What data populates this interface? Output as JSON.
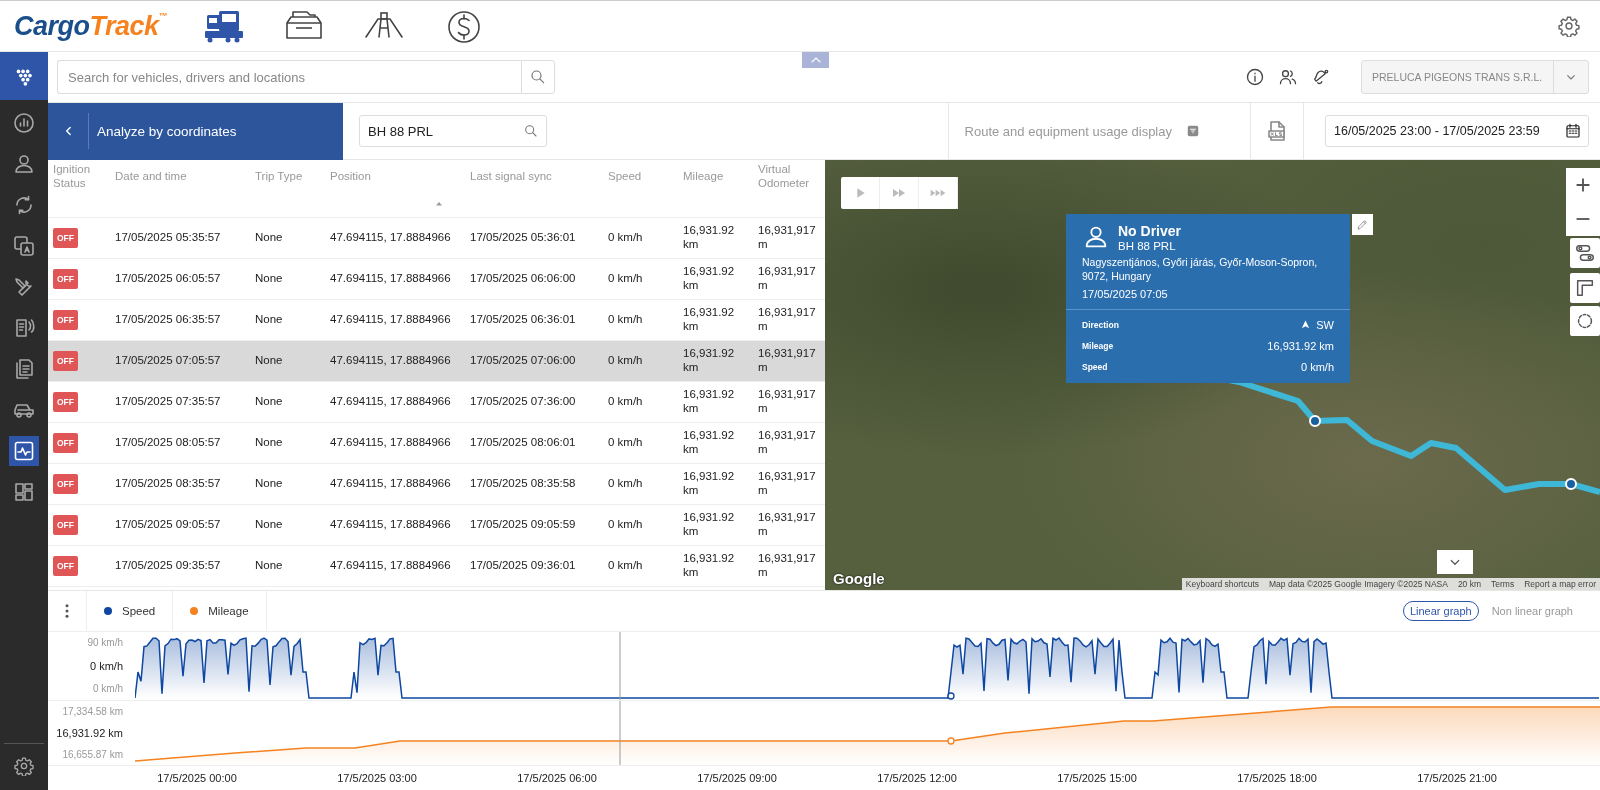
{
  "header": {
    "logo": {
      "primary": "Cargo",
      "accent": "Track",
      "mark": "™"
    },
    "modules": [
      {
        "kind": "fleet",
        "selected": true
      },
      {
        "kind": "archive",
        "selected": false
      },
      {
        "kind": "road",
        "selected": false
      },
      {
        "kind": "finance",
        "selected": false
      }
    ]
  },
  "sidebar": {
    "items": [
      {
        "kind": "stats",
        "selected": false
      },
      {
        "kind": "person",
        "selected": false
      },
      {
        "kind": "sync",
        "selected": false
      },
      {
        "kind": "translate",
        "selected": false
      },
      {
        "kind": "tools",
        "selected": false
      },
      {
        "kind": "notes",
        "selected": false
      },
      {
        "kind": "documents",
        "selected": false
      },
      {
        "kind": "vehicle",
        "selected": false
      },
      {
        "kind": "activity",
        "selected": true
      },
      {
        "kind": "dashboard",
        "selected": false
      }
    ]
  },
  "search": {
    "placeholder": "Search for vehicles, drivers and locations"
  },
  "account": {
    "company": "PRELUCA PIGEONS TRANS S.R.L."
  },
  "toolbar": {
    "title": "Analyze by coordinates",
    "vehicle_field": {
      "value": "BH 88 PRL"
    },
    "display_mode": "Route and equipment usage display",
    "date_range": "16/05/2025 23:00 - 17/05/2025 23:59"
  },
  "table": {
    "columns": [
      "Ignition Status",
      "Date and time",
      "Trip Type",
      "Position",
      "Last signal sync",
      "Speed",
      "Mileage",
      "Virtual Odometer"
    ],
    "rows": [
      {
        "ignition": "OFF",
        "date_time": "17/05/2025 05:35:57",
        "trip_type": "None",
        "position": "47.694115, 17.8884966",
        "last_sync": "17/05/2025 05:36:01",
        "speed": "0 km/h",
        "mileage": "16,931.92 km",
        "odometer": "16,931,917 m",
        "selected": false
      },
      {
        "ignition": "OFF",
        "date_time": "17/05/2025 06:05:57",
        "trip_type": "None",
        "position": "47.694115, 17.8884966",
        "last_sync": "17/05/2025 06:06:00",
        "speed": "0 km/h",
        "mileage": "16,931.92 km",
        "odometer": "16,931,917 m",
        "selected": false
      },
      {
        "ignition": "OFF",
        "date_time": "17/05/2025 06:35:57",
        "trip_type": "None",
        "position": "47.694115, 17.8884966",
        "last_sync": "17/05/2025 06:36:01",
        "speed": "0 km/h",
        "mileage": "16,931.92 km",
        "odometer": "16,931,917 m",
        "selected": false
      },
      {
        "ignition": "OFF",
        "date_time": "17/05/2025 07:05:57",
        "trip_type": "None",
        "position": "47.694115, 17.8884966",
        "last_sync": "17/05/2025 07:06:00",
        "speed": "0 km/h",
        "mileage": "16,931.92 km",
        "odometer": "16,931,917 m",
        "selected": true
      },
      {
        "ignition": "OFF",
        "date_time": "17/05/2025 07:35:57",
        "trip_type": "None",
        "position": "47.694115, 17.8884966",
        "last_sync": "17/05/2025 07:36:00",
        "speed": "0 km/h",
        "mileage": "16,931.92 km",
        "odometer": "16,931,917 m",
        "selected": false
      },
      {
        "ignition": "OFF",
        "date_time": "17/05/2025 08:05:57",
        "trip_type": "None",
        "position": "47.694115, 17.8884966",
        "last_sync": "17/05/2025 08:06:01",
        "speed": "0 km/h",
        "mileage": "16,931.92 km",
        "odometer": "16,931,917 m",
        "selected": false
      },
      {
        "ignition": "OFF",
        "date_time": "17/05/2025 08:35:57",
        "trip_type": "None",
        "position": "47.694115, 17.8884966",
        "last_sync": "17/05/2025 08:35:58",
        "speed": "0 km/h",
        "mileage": "16,931.92 km",
        "odometer": "16,931,917 m",
        "selected": false
      },
      {
        "ignition": "OFF",
        "date_time": "17/05/2025 09:05:57",
        "trip_type": "None",
        "position": "47.694115, 17.8884966",
        "last_sync": "17/05/2025 09:05:59",
        "speed": "0 km/h",
        "mileage": "16,931.92 km",
        "odometer": "16,931,917 m",
        "selected": false
      },
      {
        "ignition": "OFF",
        "date_time": "17/05/2025 09:35:57",
        "trip_type": "None",
        "position": "47.694115, 17.8884966",
        "last_sync": "17/05/2025 09:36:01",
        "speed": "0 km/h",
        "mileage": "16,931.92 km",
        "odometer": "16,931,917 m",
        "selected": false
      }
    ]
  },
  "map": {
    "popup": {
      "driver": "No Driver",
      "plate": "BH 88 PRL",
      "address": "Nagyszentjános, Győri járás, Győr-Moson-Sopron, 9072, Hungary",
      "time": "17/05/2025 07:05",
      "details": [
        {
          "kind": "direction",
          "label": "Direction",
          "value": "SW"
        },
        {
          "kind": "plain",
          "label": "Mileage",
          "value": "16,931.92 km"
        },
        {
          "kind": "plain",
          "label": "Speed",
          "value": "0 km/h"
        }
      ]
    },
    "google_logo": "Google",
    "attribution": [
      "Keyboard shortcuts",
      "Map data ©2025 Google Imagery ©2025 NASA",
      "20 km",
      "Terms",
      "Report a map error"
    ]
  },
  "chart": {
    "legend": [
      {
        "label": "Speed",
        "color": "#0d47a1"
      },
      {
        "label": "Mileage",
        "color": "#f5821f"
      }
    ],
    "modes": [
      {
        "label": "Linear graph",
        "selected": true
      },
      {
        "label": "Non linear graph",
        "selected": false
      }
    ],
    "speed_axis": [
      {
        "label": "90 km/h",
        "current": false
      },
      {
        "label": "0 km/h",
        "current": true
      },
      {
        "label": "0 km/h",
        "current": false
      }
    ],
    "mileage_axis": [
      {
        "label": "17,334.58 km",
        "current": false
      },
      {
        "label": "16,931.92 km",
        "current": true
      },
      {
        "label": "16,655.87 km",
        "current": false
      }
    ],
    "time_ticks": [
      "17/5/2025 00:00",
      "17/5/2025 03:00",
      "17/5/2025 06:00",
      "17/5/2025 09:00",
      "17/5/2025 12:00",
      "17/5/2025 15:00",
      "17/5/2025 18:00",
      "17/5/2025 21:00"
    ]
  }
}
